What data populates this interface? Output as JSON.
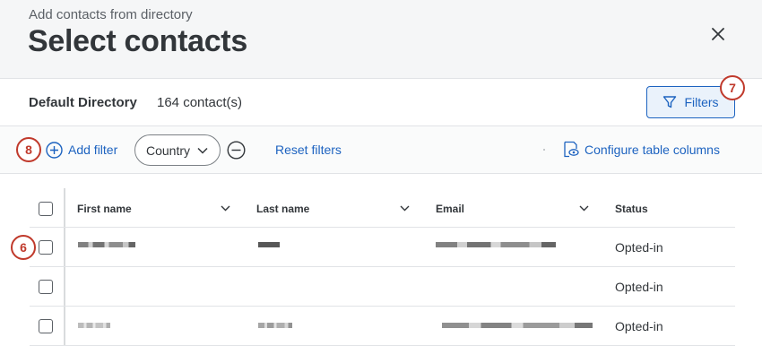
{
  "header": {
    "subtitle": "Add contacts from directory",
    "title": "Select contacts"
  },
  "directory": {
    "name": "Default Directory",
    "count": "164 contact(s)",
    "filters_label": "Filters"
  },
  "filterbar": {
    "add_filter": "Add filter",
    "country": "Country",
    "reset": "Reset filters",
    "configure": "Configure table columns"
  },
  "table": {
    "columns": [
      "First name",
      "Last name",
      "Email",
      "Status"
    ],
    "rows": [
      {
        "status": "Opted-in"
      },
      {
        "status": "Opted-in"
      },
      {
        "status": "Opted-in"
      }
    ]
  },
  "callouts": [
    "8",
    "7",
    "6"
  ],
  "colors": {
    "accent": "#1d63c0",
    "callout": "#c0392b",
    "header_bg": "#f5f6f7"
  }
}
